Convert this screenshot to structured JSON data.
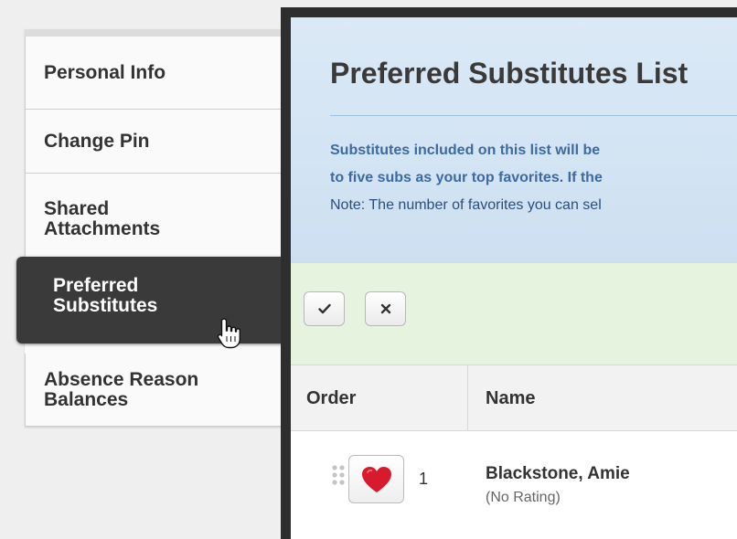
{
  "sidebar": {
    "items": [
      {
        "label": "Personal Info"
      },
      {
        "label": "Change Pin"
      },
      {
        "label_line1": "Shared",
        "label_line2": "Attachments"
      },
      {
        "label_line1": "Preferred",
        "label_line2": "Substitutes",
        "active": true
      },
      {
        "label_line1": "Absence Reason",
        "label_line2": "Balances"
      }
    ]
  },
  "panel": {
    "title": "Preferred Substitutes List",
    "description": {
      "line1": "Substitutes included on this list will be",
      "line2": "to five subs as your top favorites. If the",
      "line3": "Note: The number of favorites you can sel"
    }
  },
  "toolbar": {
    "save_icon": "check-icon",
    "cancel_icon": "x-icon"
  },
  "table": {
    "headers": {
      "order": "Order",
      "name": "Name"
    },
    "rows": [
      {
        "order": "1",
        "name": "Blackstone, Amie",
        "rating": "(No Rating)",
        "favorite": true
      }
    ]
  },
  "colors": {
    "active_nav": "#3a3a3a",
    "header_bg": "#d4e6f4",
    "toolbar_bg": "#e5f3df",
    "heart": "#d9192c",
    "link_text": "#3d6aa0"
  }
}
